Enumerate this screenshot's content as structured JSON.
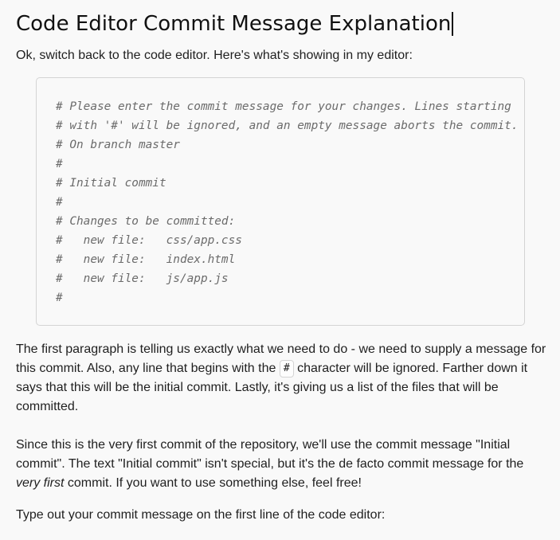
{
  "title": "Code Editor Commit Message Explanation",
  "intro": "Ok, switch back to the code editor. Here's what's showing in my editor:",
  "code_lines": [
    "# Please enter the commit message for your changes. Lines starting",
    "# with '#' will be ignored, and an empty message aborts the commit.",
    "# On branch master",
    "#",
    "# Initial commit",
    "#",
    "# Changes to be committed:",
    "#   new file:   css/app.css",
    "#   new file:   index.html",
    "#   new file:   js/app.js",
    "#"
  ],
  "paragraph1": {
    "part1": "The first paragraph is telling us exactly what we need to do - we need to supply a message for this commit. Also, any line that begins with the ",
    "code": "#",
    "part2": " character will be ignored. Farther down it says that this will be the initial commit. Lastly, it's giving us a list of the files that will be committed."
  },
  "paragraph2": {
    "part1": "Since this is the very first commit of the repository, we'll use the commit message \"Initial commit\". The text \"Initial commit\" isn't special, but it's the de facto commit message for the ",
    "emphasis": "very first",
    "part2": " commit. If you want to use something else, feel free!"
  },
  "paragraph3": "Type out your commit message on the first line of the code editor:"
}
